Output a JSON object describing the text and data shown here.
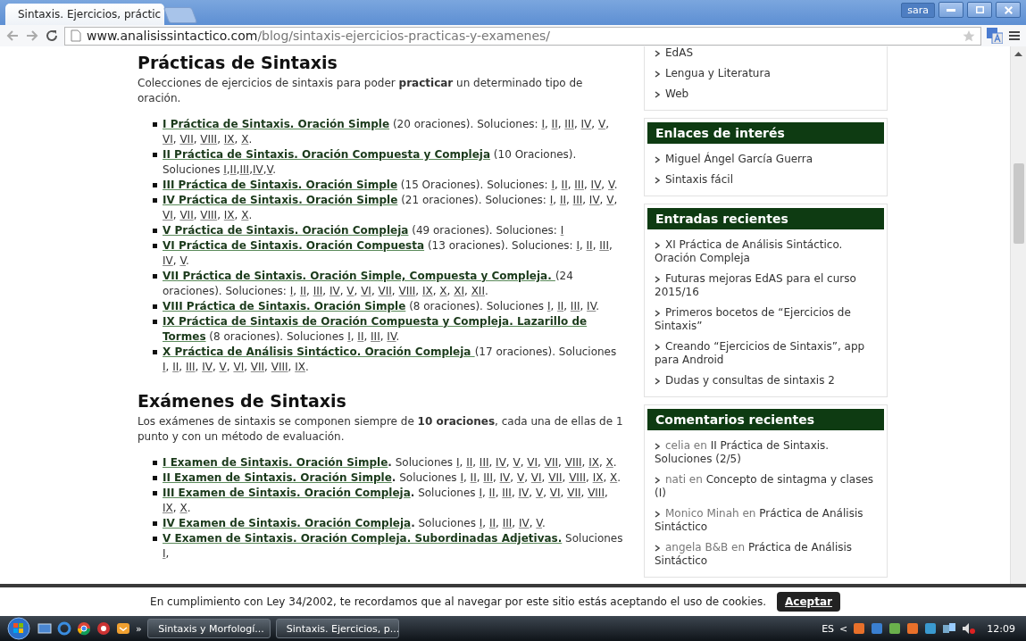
{
  "browser": {
    "tab_title": "Sintaxis. Ejercicios, práctic",
    "user": "sara",
    "url_host": "www.analisissintactico.com",
    "url_path": "/blog/sintaxis-ejercicios-practicas-y-examenes/"
  },
  "practicas": {
    "heading": "Prácticas de Sintaxis",
    "intro": "Colecciones de ejercicios de sintaxis para poder **practicar** un determinado tipo de oración.",
    "items": [
      {
        "title": "I Práctica de Sintaxis. Oración Simple",
        "note": " (20 oraciones). Soluciones: ",
        "solutions": [
          "I",
          "II",
          "III",
          "IV",
          "V",
          "VI",
          "VII",
          "VIII",
          "IX",
          "X"
        ],
        "separator": ", ",
        "ending": "."
      },
      {
        "title": "II Práctica de Sintaxis. Oración Compuesta y Compleja",
        "note": " (10 Oraciones). Soluciones ",
        "solutions": [
          "I",
          "II",
          "III",
          "IV",
          "V"
        ],
        "separator": ",",
        "ending": "."
      },
      {
        "title": "III Práctica de Sintaxis. Oración Simple",
        "note": " (15 Oraciones). Soluciones: ",
        "solutions": [
          "I",
          "II",
          "III",
          "IV",
          "V"
        ],
        "separator": ", ",
        "ending": "."
      },
      {
        "title": "IV Práctica de Sintaxis. Oración Simple",
        "note": " (21 oraciones). Soluciones: ",
        "solutions": [
          "I",
          "II",
          "III",
          "IV",
          "V",
          "VI",
          "VII",
          "VIII",
          "IX",
          "X"
        ],
        "separator": ", ",
        "ending": "."
      },
      {
        "title": "V Práctica de Sintaxis. Oración Compleja",
        "note": " (49 oraciones). Soluciones: ",
        "solutions": [
          "I"
        ]
      },
      {
        "title": "VI Práctica de Sintaxis. Oración Compuesta",
        "note": " (13 oraciones). Soluciones: ",
        "solutions": [
          "I",
          "II",
          "III",
          "IV",
          "V"
        ],
        "separator": ", ",
        "ending": "."
      },
      {
        "title": "VII Práctica de Sintaxis. Oración Simple, Compuesta y Compleja. ",
        "note": "(24 oraciones). Soluciones: ",
        "solutions": [
          "I",
          "II",
          "III",
          "IV",
          "V",
          "VI",
          "VII",
          "VIII",
          "IX",
          "X",
          "XI",
          "XII"
        ],
        "separator": ", ",
        "ending": "."
      },
      {
        "title": "VIII Práctica de Sintaxis. Oración Simple",
        "note": " (8 oraciones). Soluciones ",
        "solutions": [
          "I",
          "II",
          "III",
          "IV"
        ],
        "separator": ", ",
        "ending": "."
      },
      {
        "title": [
          "IX Práctica de Sintaxis de Oración Compuesta y Compleja. Lazarillo de",
          "Tormes"
        ],
        "note": "  (8 oraciones). Soluciones ",
        "solutions": [
          "I",
          "II",
          "III",
          "IV"
        ],
        "separator": ", ",
        "ending": "."
      },
      {
        "title": "X Práctica de Análisis Sintáctico. Oración Compleja ",
        "note": "(17 oraciones). Soluciones ",
        "solutions": [
          "I",
          "II",
          "III",
          "IV",
          "V",
          "VI",
          "VII",
          "VIII",
          "IX"
        ],
        "separator": ", ",
        "ending": "."
      }
    ]
  },
  "examenes": {
    "heading": "Exámenes de Sintaxis",
    "intro": "Los exámenes de sintaxis se componen siempre de **10 oraciones**, cada una de ellas de 1 punto y con un método de evaluación.",
    "items": [
      {
        "title": "I Examen de Sintaxis. Oración Simple",
        "note": "**.** Soluciones ",
        "solutions": [
          "I",
          "II",
          "III",
          "IV",
          "V",
          "VI",
          "VII",
          "VIII",
          "IX",
          "X"
        ],
        "separator": ", ",
        "ending": "."
      },
      {
        "title": "II Examen de Sintaxis. Oración Simple",
        "note": "**.** Soluciones ",
        "solutions": [
          "I",
          "II",
          "III",
          "IV",
          "V",
          "VI",
          "VII",
          "VIII",
          "IX",
          "X"
        ],
        "separator": ", ",
        "ending": "."
      },
      {
        "title": "III Examen de Sintaxis. Oración Compleja",
        "note": "**.** Soluciones ",
        "solutions": [
          "I",
          "II",
          "III",
          "IV",
          "V",
          "VI",
          "VII",
          "VIII",
          "IX",
          "X"
        ],
        "separator": ", ",
        "ending": "."
      },
      {
        "title": "IV Examen de Sintaxis. Oración Compleja",
        "note": "**.** Soluciones ",
        "solutions": [
          "I",
          "II",
          "III",
          "IV",
          "V"
        ],
        "separator": ", ",
        "ending": "."
      },
      {
        "title": "V Examen de Sintaxis. Oración Compleja. Subordinadas Adjetivas.",
        "note": " Soluciones ",
        "solutions": [
          "I"
        ],
        "ending": ","
      }
    ]
  },
  "sidebar": {
    "widgets": [
      {
        "items": [
          "EdAS",
          "Lengua y Literatura",
          "Web"
        ]
      },
      {
        "heading": "Enlaces de interés",
        "items": [
          "Miguel Ángel García Guerra",
          "Sintaxis fácil"
        ]
      },
      {
        "heading": "Entradas recientes",
        "items": [
          "XI Práctica de Análisis Sintáctico. Oración Compleja",
          "Futuras mejoras EdAS para el curso 2015/16",
          "Primeros bocetos de “Ejercicios de Sintaxis”",
          "Creando “Ejercicios de Sintaxis”, app para Android",
          "Dudas y consultas de sintaxis 2"
        ]
      },
      {
        "heading": "Comentarios recientes",
        "comments": [
          {
            "author": "celia en",
            "link": "II Práctica de Sintaxis. Soluciones (2/5)"
          },
          {
            "author": "nati en",
            "link": "Concepto de sintagma y clases (I)"
          },
          {
            "author": "Monico Minah en",
            "link": "Práctica de Análisis Sintáctico"
          },
          {
            "author": "angela B&B en",
            "link": "Práctica de Análisis Sintáctico"
          }
        ]
      }
    ]
  },
  "cookie_bar": {
    "text": "En cumplimiento con Ley 34/2002, te recordamos que al navegar por este sitio estás aceptando el uso de cookies.",
    "button": "Aceptar"
  },
  "taskbar": {
    "overflow": "»",
    "tasks": [
      "Sintaxis y Morfologí...",
      "Sintaxis. Ejercicios, p..."
    ],
    "language": "ES",
    "tray_expand": "<",
    "time": "12:09"
  }
}
